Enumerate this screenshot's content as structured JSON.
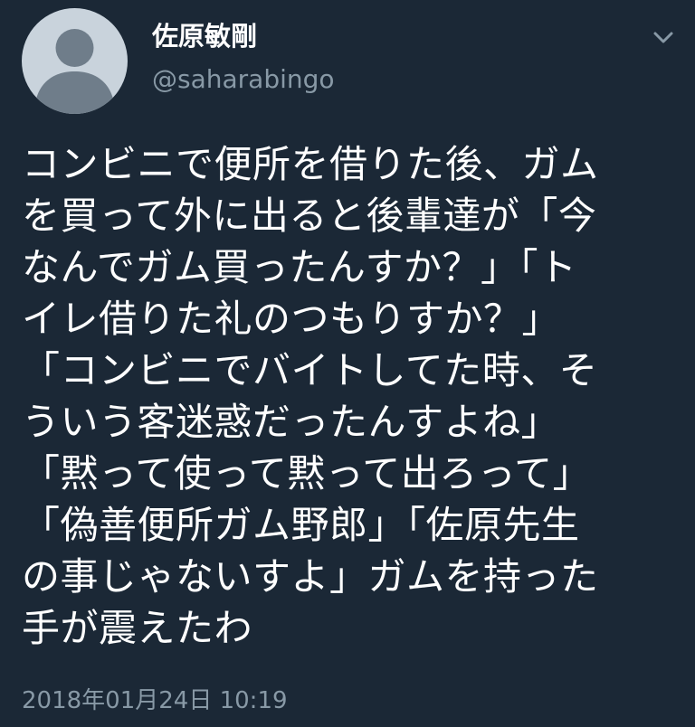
{
  "user": {
    "display_name": "佐原敏剛",
    "handle": "@saharabingo"
  },
  "icons": {
    "avatar": "default-profile-silhouette",
    "menu": "chevron-down-icon"
  },
  "tweet": {
    "lines": [
      "コンビニで便所を借りた後、ガム",
      "を買って外に出ると後輩達が「今",
      "なんでガム買ったんすか？」「ト",
      "イレ借りた礼のつもりすか？」",
      "「コンビニでバイトしてた時、そ",
      "ういう客迷惑だったんすよね」",
      "「黙って使って黙って出ろって」",
      "「偽善便所ガム野郎」「佐原先生",
      "の事じゃないすよ」ガムを持った",
      "手が震えたわ"
    ],
    "timestamp": "2018年01月24日 10:19"
  },
  "colors": {
    "background": "#1b2836",
    "text_primary": "#ffffff",
    "text_secondary": "#8899a6",
    "avatar_bg": "#c9d3dc",
    "avatar_figure": "#6f7d8a"
  }
}
